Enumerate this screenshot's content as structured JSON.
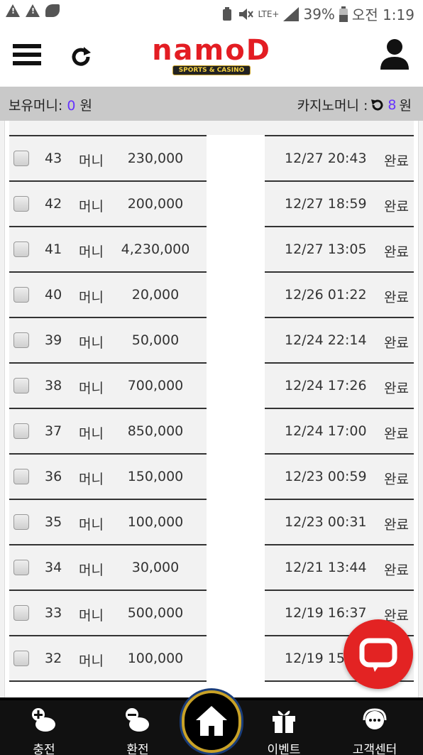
{
  "status_bar": {
    "battery": "39%",
    "network": "LTE+",
    "time": "오전 1:19"
  },
  "header": {
    "logo_text": "namoD",
    "logo_tagline": "SPORTS & CASINO"
  },
  "money_bar": {
    "held_label": "보유머니:",
    "held_value": "0",
    "held_unit": "원",
    "casino_label": "카지노머니 :",
    "casino_value": "8",
    "casino_unit": "원"
  },
  "rows": [
    {
      "num": "43",
      "type": "머니",
      "amount": "230,000",
      "date": "12/27 20:43",
      "status": "완료"
    },
    {
      "num": "42",
      "type": "머니",
      "amount": "200,000",
      "date": "12/27 18:59",
      "status": "완료"
    },
    {
      "num": "41",
      "type": "머니",
      "amount": "4,230,000",
      "date": "12/27 13:05",
      "status": "완료"
    },
    {
      "num": "40",
      "type": "머니",
      "amount": "20,000",
      "date": "12/26 01:22",
      "status": "완료"
    },
    {
      "num": "39",
      "type": "머니",
      "amount": "50,000",
      "date": "12/24 22:14",
      "status": "완료"
    },
    {
      "num": "38",
      "type": "머니",
      "amount": "700,000",
      "date": "12/24 17:26",
      "status": "완료"
    },
    {
      "num": "37",
      "type": "머니",
      "amount": "850,000",
      "date": "12/24 17:00",
      "status": "완료"
    },
    {
      "num": "36",
      "type": "머니",
      "amount": "150,000",
      "date": "12/23 00:59",
      "status": "완료"
    },
    {
      "num": "35",
      "type": "머니",
      "amount": "100,000",
      "date": "12/23 00:31",
      "status": "완료"
    },
    {
      "num": "34",
      "type": "머니",
      "amount": "30,000",
      "date": "12/21 13:44",
      "status": "완료"
    },
    {
      "num": "33",
      "type": "머니",
      "amount": "500,000",
      "date": "12/19 16:37",
      "status": "완료"
    },
    {
      "num": "32",
      "type": "머니",
      "amount": "100,000",
      "date": "12/19 15:",
      "status": ""
    }
  ],
  "bottom_nav": {
    "charge": "충전",
    "exchange": "환전",
    "event": "이벤트",
    "support": "고객센터"
  }
}
